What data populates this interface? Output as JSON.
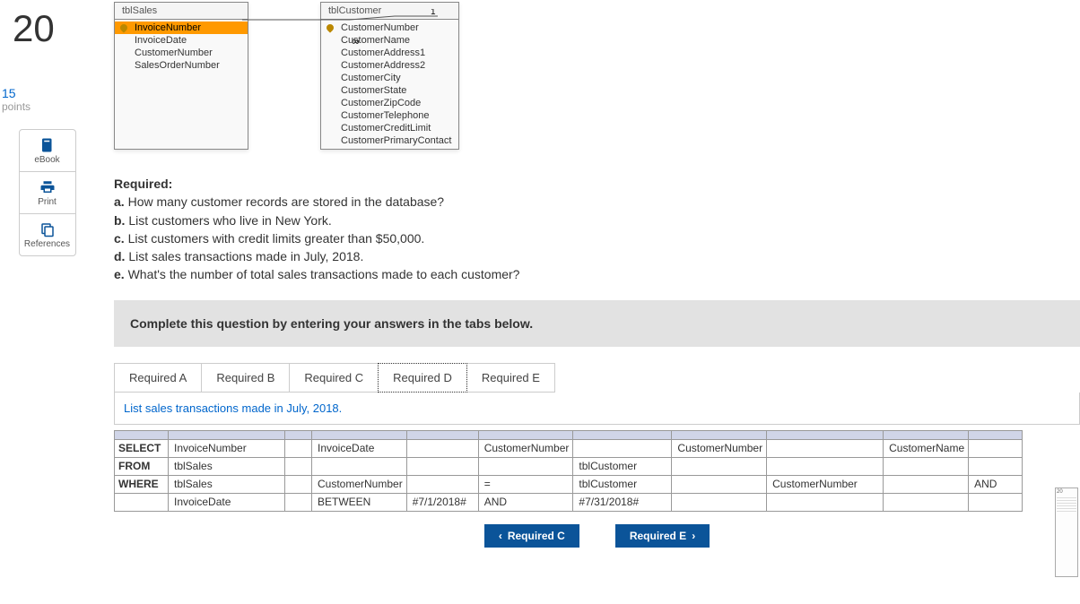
{
  "sidebar": {
    "question_number": "20",
    "points_value": "15",
    "points_label": "points",
    "tools": [
      {
        "icon": "ebook",
        "label": "eBook"
      },
      {
        "icon": "print",
        "label": "Print"
      },
      {
        "icon": "references",
        "label": "References"
      }
    ]
  },
  "schema": {
    "tables": [
      {
        "name": "tblSales",
        "fields": [
          {
            "name": "InvoiceNumber",
            "pk": true,
            "highlight": true
          },
          {
            "name": "InvoiceDate"
          },
          {
            "name": "CustomerNumber"
          },
          {
            "name": "SalesOrderNumber"
          }
        ]
      },
      {
        "name": "tblCustomer",
        "fields": [
          {
            "name": "CustomerNumber",
            "pk": true
          },
          {
            "name": "CustomerName"
          },
          {
            "name": "CustomerAddress1"
          },
          {
            "name": "CustomerAddress2"
          },
          {
            "name": "CustomerCity"
          },
          {
            "name": "CustomerState"
          },
          {
            "name": "CustomerZipCode"
          },
          {
            "name": "CustomerTelephone"
          },
          {
            "name": "CustomerCreditLimit"
          },
          {
            "name": "CustomerPrimaryContact"
          }
        ]
      }
    ],
    "relation": {
      "left_card": "∞",
      "right_card": "1"
    }
  },
  "required": {
    "title": "Required:",
    "items": [
      {
        "label": "a.",
        "text": "How many customer records are stored in the database?"
      },
      {
        "label": "b.",
        "text": "List customers who live in New York."
      },
      {
        "label": "c.",
        "text": "List customers with credit limits greater than $50,000."
      },
      {
        "label": "d.",
        "text": "List sales transactions made in July, 2018."
      },
      {
        "label": "e.",
        "text": "What's the number of total sales transactions made to each customer?"
      }
    ]
  },
  "instruction": "Complete this question by entering your answers in the tabs below.",
  "tabs": [
    "Required A",
    "Required B",
    "Required C",
    "Required D",
    "Required E"
  ],
  "active_tab": "Required D",
  "task_description": "List sales transactions made in July, 2018.",
  "sql": {
    "rows": [
      {
        "kw": "SELECT",
        "cells": [
          "InvoiceNumber",
          "",
          "InvoiceDate",
          "",
          "CustomerNumber",
          "",
          "CustomerNumber",
          "",
          "CustomerName",
          ""
        ]
      },
      {
        "kw": "FROM",
        "cells": [
          "tblSales",
          "",
          "",
          "",
          "",
          "tblCustomer",
          "",
          "",
          "",
          ""
        ]
      },
      {
        "kw": "WHERE",
        "cells": [
          "tblSales",
          "",
          "CustomerNumber",
          "",
          "=",
          "tblCustomer",
          "",
          "CustomerNumber",
          "",
          "AND"
        ]
      },
      {
        "kw": "",
        "cells": [
          "InvoiceDate",
          "",
          "BETWEEN",
          "#7/1/2018#",
          "AND",
          "#7/31/2018#",
          "",
          "",
          "",
          ""
        ]
      }
    ]
  },
  "nav": {
    "prev": "Required C",
    "next": "Required E"
  }
}
